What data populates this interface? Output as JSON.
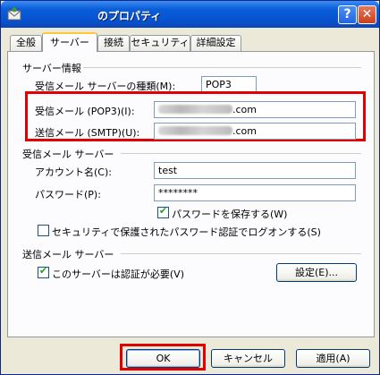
{
  "window": {
    "title": "のプロパティ",
    "help": "?",
    "close": "✕"
  },
  "tabs": [
    {
      "label": "全般"
    },
    {
      "label": "サーバー"
    },
    {
      "label": "接続"
    },
    {
      "label": "セキュリティ"
    },
    {
      "label": "詳細設定"
    }
  ],
  "server_info": {
    "heading": "サーバー情報",
    "incoming_type_label": "受信メール サーバーの種類(M):",
    "incoming_type_value": "POP3",
    "incoming_label": "受信メール (POP3)(I):",
    "incoming_value_suffix": ".com",
    "outgoing_label": "送信メール (SMTP)(U):",
    "outgoing_value_suffix": ".com"
  },
  "incoming_server": {
    "heading": "受信メール サーバー",
    "account_label": "アカウント名(C):",
    "account_value": "test",
    "password_label": "パスワード(P):",
    "password_value": "********",
    "remember_label": "パスワードを保存する(W)",
    "remember_checked": true,
    "spa_label": "セキュリティで保護されたパスワード認証でログオンする(S)",
    "spa_checked": false
  },
  "outgoing_server": {
    "heading": "送信メール サーバー",
    "auth_label": "このサーバーは認証が必要(V)",
    "auth_checked": true,
    "settings_label": "設定(E)..."
  },
  "footer": {
    "ok": "OK",
    "cancel": "キャンセル",
    "apply": "適用(A)"
  },
  "colors": {
    "highlight": "#e00000",
    "titlebar": "#0753d1"
  }
}
